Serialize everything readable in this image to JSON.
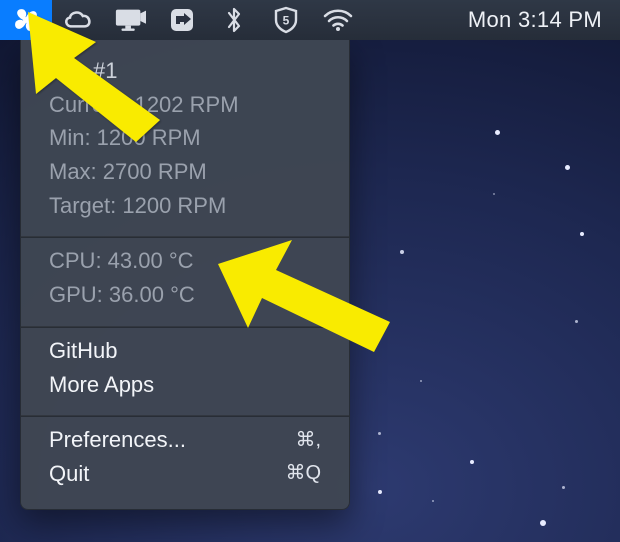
{
  "menubar": {
    "clock": "Mon 3:14 PM"
  },
  "dropdown": {
    "fan": {
      "title": "Fan #1",
      "current": "Current: 1202 RPM",
      "min": "Min: 1200 RPM",
      "max": "Max: 2700 RPM",
      "target": "Target: 1200 RPM"
    },
    "temps": {
      "cpu": "CPU: 43.00 °C",
      "gpu": "GPU: 36.00 °C"
    },
    "links": {
      "github": "GitHub",
      "more_apps": "More Apps"
    },
    "actions": {
      "preferences": "Preferences...",
      "preferences_shortcut": "⌘,",
      "quit": "Quit",
      "quit_shortcut": "⌘Q"
    }
  },
  "colors": {
    "accent": "#097dff",
    "arrow": "#f9eb00"
  }
}
